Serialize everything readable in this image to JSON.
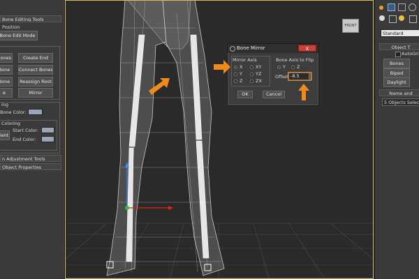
{
  "left_panel": {
    "title": "Bone Editing Tools",
    "position_label": "Position",
    "edit_mode_button": "Bone Edit Mode",
    "buttons": [
      {
        "label": "Bones"
      },
      {
        "label": "Create End"
      },
      {
        "label": "Bone"
      },
      {
        "label": "Connect Bones"
      },
      {
        "label": "Bone"
      },
      {
        "label": "Reassign Root"
      },
      {
        "label": "e"
      },
      {
        "label": "Mirror"
      }
    ],
    "fin_label": "ing",
    "bone_color_label": "Bone Color:",
    "coloring_label": "Coloring",
    "gradient_label": "dient",
    "start_color_label": "Start Color:",
    "end_color_label": "End Color:",
    "adjustment_tools": "n Adjustment Tools",
    "object_properties": "Object Properties"
  },
  "viewport": {
    "viewcube_label": "FRONT"
  },
  "dialog": {
    "title": "Bone Mirror",
    "close_glyph": "x",
    "mirror_axis_label": "Mirror Axis",
    "mirror_axes": [
      "X",
      "XY",
      "Y",
      "YZ",
      "Z",
      "ZX"
    ],
    "selected_mirror_axis": "X",
    "flip_label": "Bone Axis to Flip",
    "flip_axes": [
      "Y",
      "Z"
    ],
    "selected_flip_axis": "Y",
    "offset_label": "Offset",
    "offset_value": "-8.5",
    "ok_button": "OK",
    "cancel_button": "Cancel"
  },
  "right_panel": {
    "dropdown_value": "Standard",
    "object_type_label": "Object T",
    "autogrid_label": "AutoGri",
    "buttons": [
      "Bones",
      "Biped",
      "Daylight"
    ],
    "name_label": "Name and",
    "selection_text": "5 Objects Selecte"
  },
  "colors": {
    "accent_arrow": "#f08a1c",
    "highlight_box": "#f07a10",
    "swatch": "#9aa6b8"
  }
}
